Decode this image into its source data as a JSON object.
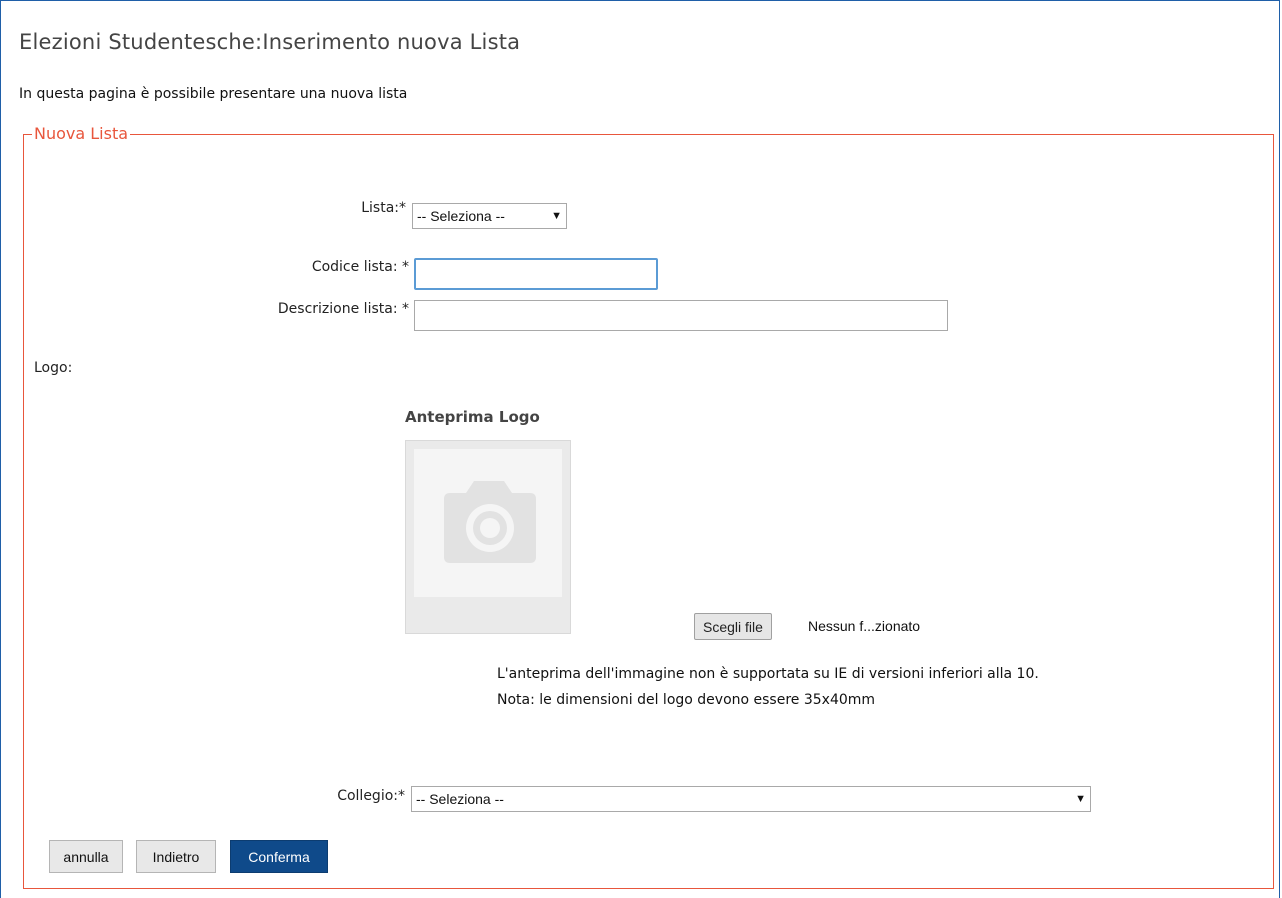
{
  "page": {
    "title": "Elezioni Studentesche:Inserimento nuova Lista",
    "intro": "In questa pagina è possibile presentare una nuova lista"
  },
  "form": {
    "legend": "Nuova Lista",
    "lista_label": "Lista:*",
    "lista_value": "-- Seleziona --",
    "codice_label": "Codice lista: *",
    "codice_value": "",
    "descrizione_label": "Descrizione lista: *",
    "descrizione_value": "",
    "logo_label": "Logo:",
    "preview_title": "Anteprima Logo",
    "file_button": "Scegli file",
    "file_status": "Nessun f...zionato",
    "note_ie": "L'anteprima dell'immagine non è supportata su IE di versioni inferiori alla 10.",
    "note_size": "Nota: le dimensioni del logo devono essere 35x40mm",
    "collegio_label": "Collegio:*",
    "collegio_value": "-- Seleziona --"
  },
  "actions": {
    "annulla": "annulla",
    "indietro": "Indietro",
    "conferma": "Conferma"
  },
  "icons": {
    "dropdown": "chevron-down-icon",
    "placeholder": "camera-icon"
  },
  "colors": {
    "fieldset_border": "#e8563c",
    "primary_button": "#0f4a8a",
    "focus": "#5b9bd5"
  }
}
